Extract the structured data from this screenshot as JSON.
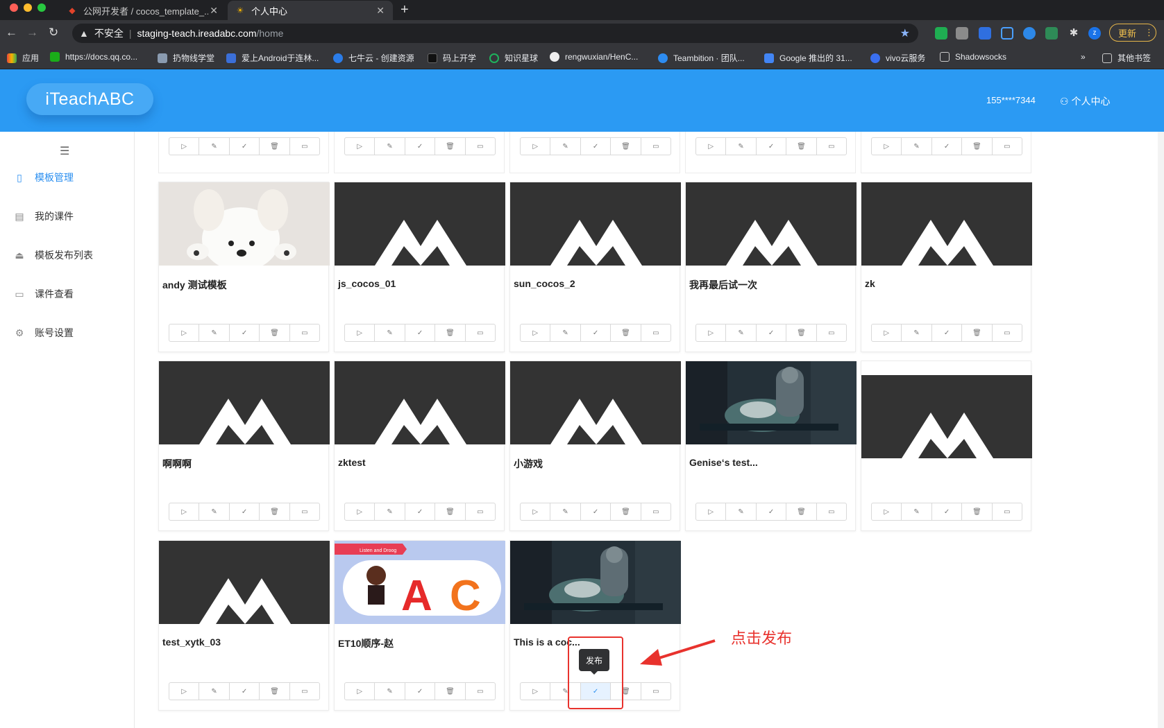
{
  "browser": {
    "tabs": [
      {
        "title": "公网开发者 / cocos_template_...",
        "icon": "gitlab-icon",
        "active": false
      },
      {
        "title": "个人中心",
        "icon": "sun-icon",
        "active": true
      }
    ],
    "new_tab": "+",
    "address": {
      "security_label": "不安全",
      "host": "staging-teach.ireadabc.com",
      "path": "/home"
    },
    "update_label": "更新",
    "bookmarks": [
      {
        "label": "应用",
        "color": "#e8453c"
      },
      {
        "label": "https://docs.qq.co...",
        "color": "#1aad19"
      },
      {
        "label": "扔物线学堂",
        "color": "#8a9bb0"
      },
      {
        "label": "爱上Android于连林...",
        "color": "#3b6fd8"
      },
      {
        "label": "七牛云 - 创建资源",
        "color": "#2b7de9"
      },
      {
        "label": "码上开学",
        "color": "#111111"
      },
      {
        "label": "知识星球",
        "color": "#1fb35d"
      },
      {
        "label": "rengwuxian/HenC...",
        "color": "#eeeeee"
      },
      {
        "label": "Teambition · 团队...",
        "color": "#2d8cf0"
      },
      {
        "label": "Google 推出的 31...",
        "color": "#4285f4"
      },
      {
        "label": "vivo云服务",
        "color": "#3a6ff0"
      },
      {
        "label": "Shadowsocks",
        "color": "#cccccc"
      }
    ],
    "bookmarks_more": "»",
    "other_bookmarks": "其他书签"
  },
  "header": {
    "logo": "iTeachABC",
    "phone": "155****7344",
    "user_center": "个人中心"
  },
  "sidebar": {
    "items": [
      {
        "label": "模板管理",
        "icon": "tablet-icon",
        "active": true
      },
      {
        "label": "我的课件",
        "icon": "book-icon",
        "active": false
      },
      {
        "label": "模板发布列表",
        "icon": "publish-icon",
        "active": false
      },
      {
        "label": "课件查看",
        "icon": "monitor-icon",
        "active": false
      },
      {
        "label": "账号设置",
        "icon": "gear-icon",
        "active": false
      }
    ]
  },
  "cards": [
    {
      "name": "andy 测试模板",
      "thumb": "puppy"
    },
    {
      "name": "js_cocos_01",
      "thumb": "logo"
    },
    {
      "name": "sun_cocos_2",
      "thumb": "logo"
    },
    {
      "name": "我再最后试一次",
      "thumb": "logo"
    },
    {
      "name": "zk",
      "thumb": "logo"
    },
    {
      "name": "啊啊啊",
      "thumb": "logo"
    },
    {
      "name": "zktest",
      "thumb": "logo"
    },
    {
      "name": "小游戏",
      "thumb": "logo"
    },
    {
      "name": "Genise‘s test...",
      "thumb": "scifi"
    },
    {
      "name": "",
      "thumb": "logo"
    },
    {
      "name": "test_xytk_03",
      "thumb": "logo"
    },
    {
      "name": "ET10顺序-赵",
      "thumb": "ac"
    },
    {
      "name": "This is a coc...",
      "thumb": "scifi"
    }
  ],
  "actions": [
    {
      "icon": "play-icon",
      "glyph": "▷"
    },
    {
      "icon": "edit-icon",
      "glyph": "✎"
    },
    {
      "icon": "publish-icon",
      "glyph": "✓"
    },
    {
      "icon": "delete-icon",
      "glyph": "🗑"
    },
    {
      "icon": "preview-icon",
      "glyph": "▭"
    }
  ],
  "tooltip": "发布",
  "thumb_ac": {
    "banner": "Listen and Droog",
    "letters": "A C"
  },
  "annotation": {
    "text": "点击发布",
    "color": "#e8322d"
  }
}
